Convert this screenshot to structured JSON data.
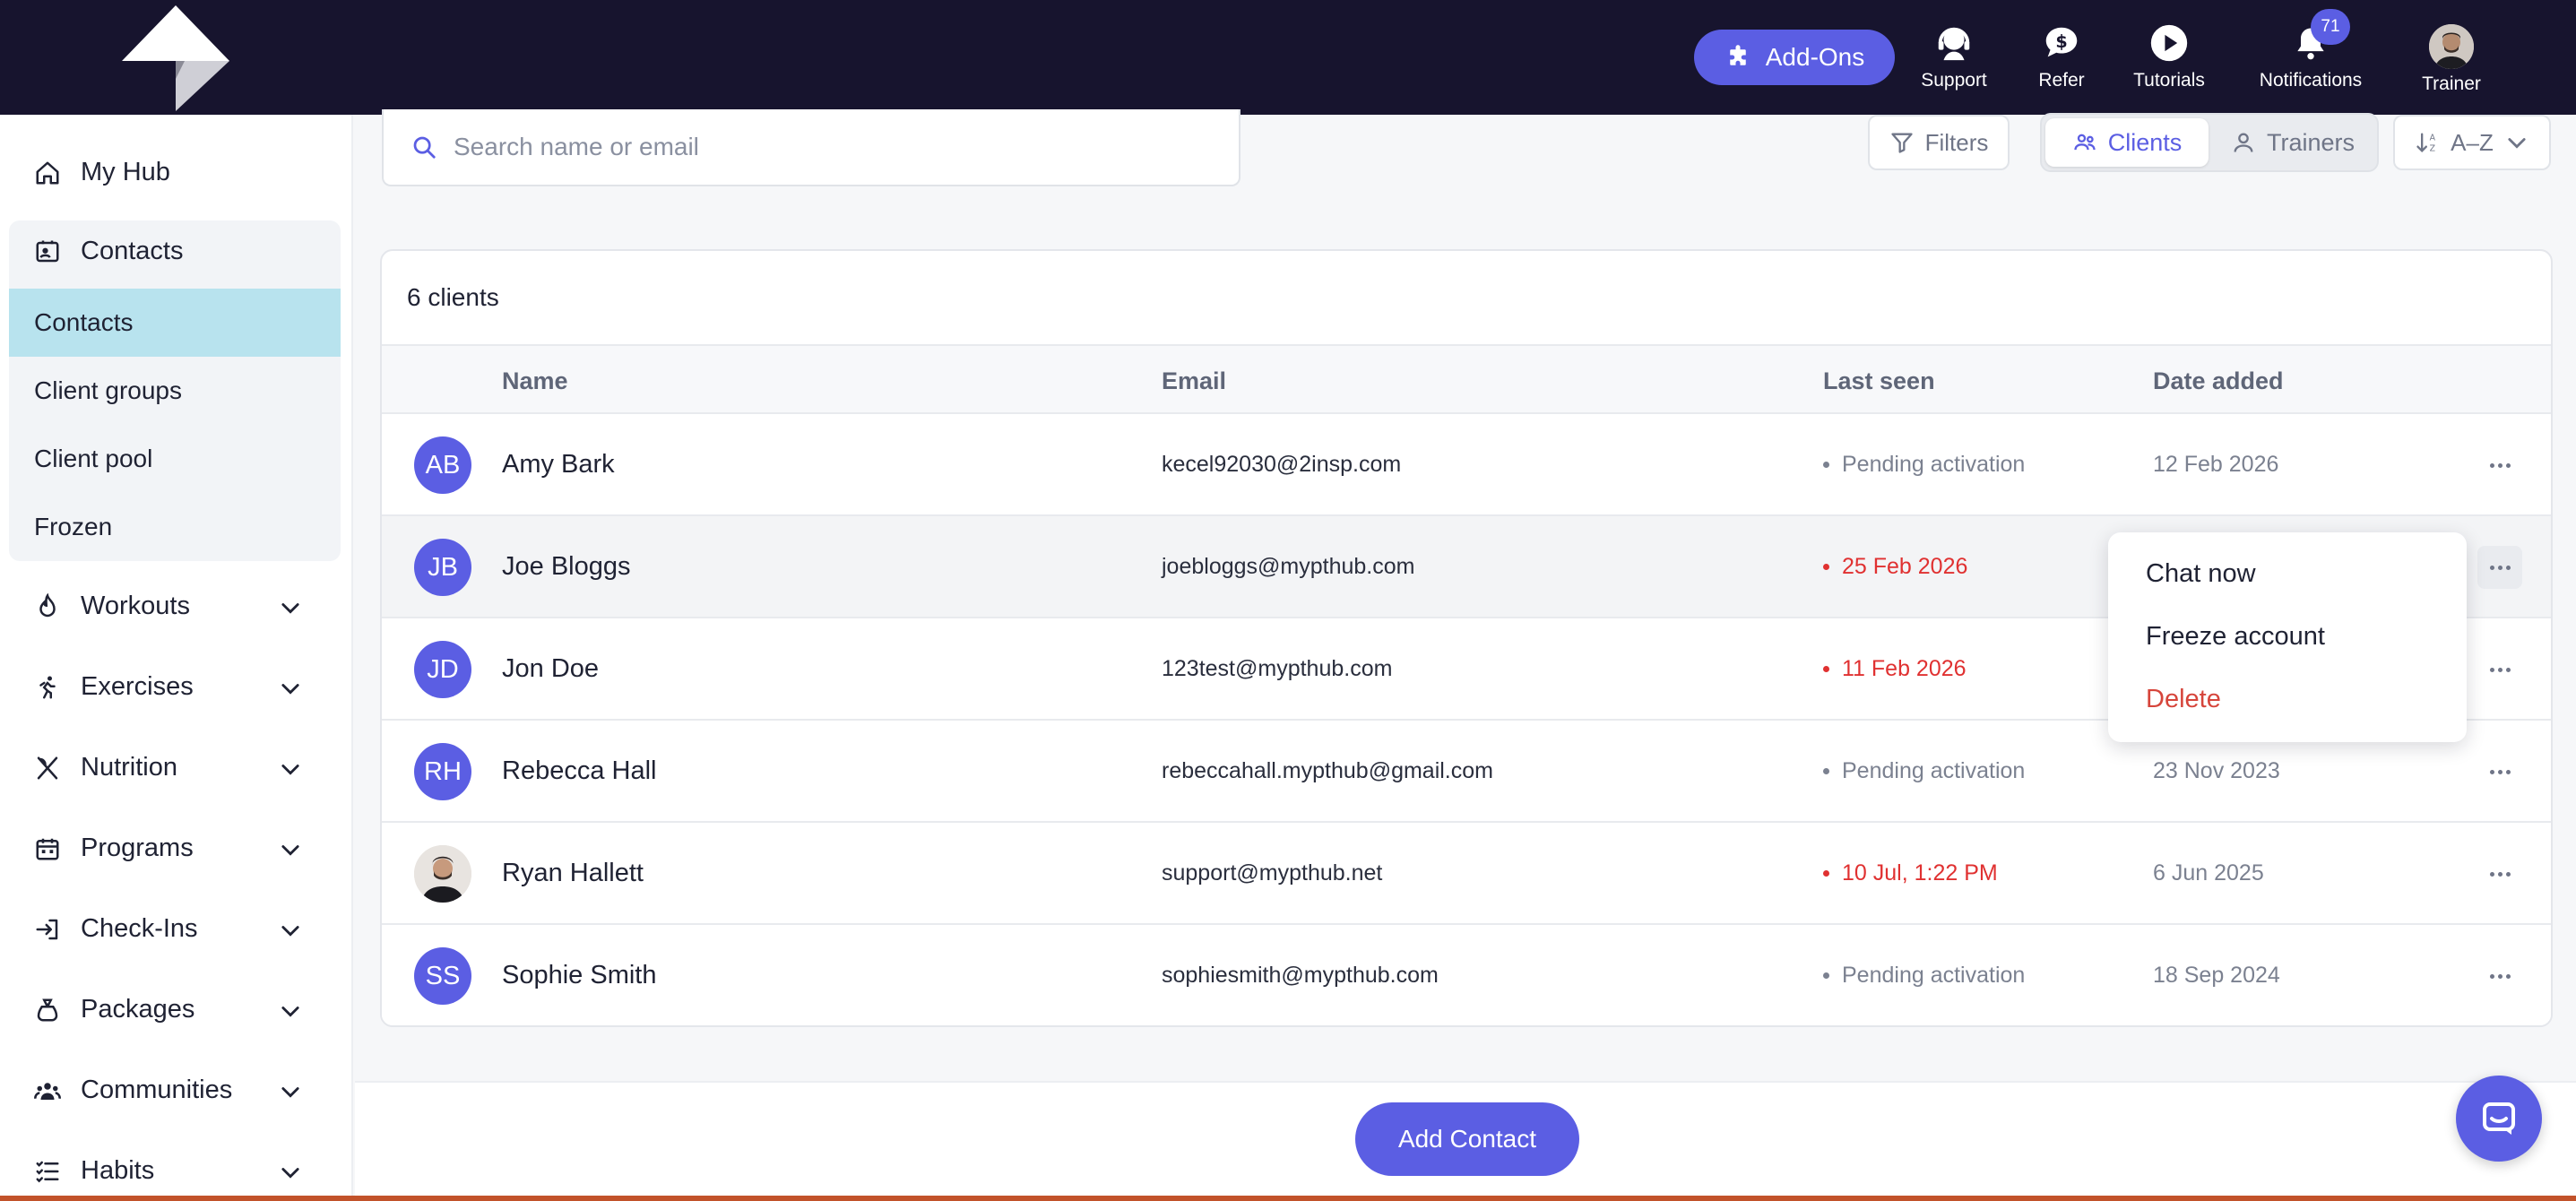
{
  "header": {
    "addons_label": "Add-Ons",
    "nav": [
      {
        "label": "Support",
        "icon": "headset-icon"
      },
      {
        "label": "Refer",
        "icon": "dollar-chat-icon"
      },
      {
        "label": "Tutorials",
        "icon": "play-icon"
      },
      {
        "label": "Notifications",
        "icon": "bell-icon",
        "badge": "71"
      },
      {
        "label": "Trainer",
        "icon": "avatar"
      }
    ]
  },
  "sidebar": {
    "my_hub": "My Hub",
    "contacts": "Contacts",
    "contacts_sub": [
      "Contacts",
      "Client groups",
      "Client pool",
      "Frozen"
    ],
    "active_sub": "Contacts",
    "sections": [
      "Workouts",
      "Exercises",
      "Nutrition",
      "Programs",
      "Check-Ins",
      "Packages",
      "Communities",
      "Habits"
    ]
  },
  "toolbar": {
    "search_placeholder": "Search name or email",
    "filters_label": "Filters",
    "clients_label": "Clients",
    "trainers_label": "Trainers",
    "sort_label": "A–Z"
  },
  "table": {
    "count_label": "6 clients",
    "columns": [
      "Name",
      "Email",
      "Last seen",
      "Date added"
    ],
    "rows": [
      {
        "initials": "AB",
        "name": "Amy Bark",
        "email": "kecel92030@2insp.com",
        "last_seen": "Pending activation",
        "seen_status": "pending",
        "date_added": "12 Feb 2026"
      },
      {
        "initials": "JB",
        "name": "Joe Bloggs",
        "email": "joebloggs@mypthub.com",
        "last_seen": "25 Feb 2026",
        "seen_status": "overdue",
        "date_added": ""
      },
      {
        "initials": "JD",
        "name": "Jon Doe",
        "email": "123test@mypthub.com",
        "last_seen": "11 Feb 2026",
        "seen_status": "overdue",
        "date_added": ""
      },
      {
        "initials": "RH",
        "name": "Rebecca Hall",
        "email": "rebeccahall.mypthub@gmail.com",
        "last_seen": "Pending activation",
        "seen_status": "pending",
        "date_added": "23 Nov 2023"
      },
      {
        "initials": "",
        "name": "Ryan Hallett",
        "email": "support@mypthub.net",
        "last_seen": "10 Jul, 1:22 PM",
        "seen_status": "overdue",
        "date_added": "6 Jun 2025"
      },
      {
        "initials": "SS",
        "name": "Sophie Smith",
        "email": "sophiesmith@mypthub.com",
        "last_seen": "Pending activation",
        "seen_status": "pending",
        "date_added": "18 Sep 2024"
      }
    ]
  },
  "row_menu": {
    "items": [
      "Chat now",
      "Freeze account",
      "Delete"
    ]
  },
  "footer": {
    "add_contact_label": "Add Contact"
  },
  "colors": {
    "topbar": "#17142e",
    "accent": "#5b5ee3",
    "active_nav": "#b8e3ee",
    "overdue": "#e03131",
    "danger": "#d6453b"
  }
}
